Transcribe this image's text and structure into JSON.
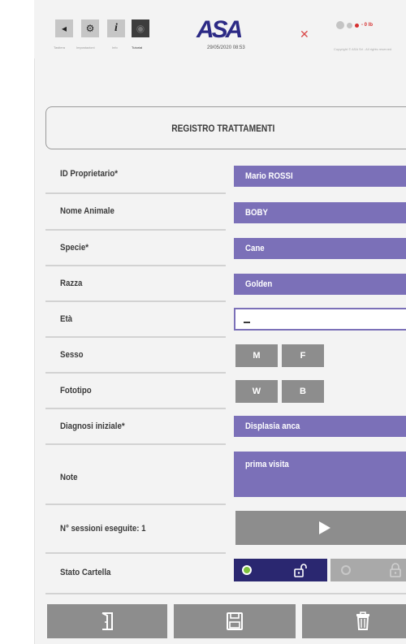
{
  "header": {
    "buttons": [
      {
        "icon": "back-arrow-icon",
        "glyph": "◂",
        "label": "Tastiera"
      },
      {
        "icon": "gear-icon",
        "glyph": "⚙",
        "label": "Impostazioni"
      },
      {
        "icon": "info-icon",
        "glyph": "i",
        "label": "Info"
      },
      {
        "icon": "eye-icon",
        "glyph": "◉",
        "label": "Tutorial"
      }
    ],
    "logo": "ASA",
    "datetime": "29/05/2020  08:53",
    "close_glyph": "✕",
    "status_text": "- 0 lb",
    "copyright": "Copyright © ASA Srl - All rights reserved"
  },
  "page_title": "REGISTRO TRATTAMENTI",
  "form": {
    "owner": {
      "label": "ID Proprietario*",
      "value": "Mario ROSSI"
    },
    "animal_name": {
      "label": "Nome Animale",
      "value": "BOBY"
    },
    "species": {
      "label": "Specie*",
      "value": "Cane"
    },
    "breed": {
      "label": "Razza",
      "value": "Golden"
    },
    "age": {
      "label": "Età",
      "value": ""
    },
    "sex": {
      "label": "Sesso",
      "options": [
        "M",
        "F"
      ]
    },
    "phototype": {
      "label": "Fototipo",
      "options": [
        "W",
        "B"
      ]
    },
    "diagnosis": {
      "label": "Diagnosi iniziale*",
      "value": "Displasia anca"
    },
    "notes": {
      "label": "Note",
      "value": "prima visita"
    },
    "sessions": {
      "label": "N° sessioni eseguite: 1"
    },
    "record_status": {
      "label": "Stato Cartella",
      "selected": "open"
    }
  },
  "bottom_bar": {
    "buttons": [
      {
        "name": "exit-button",
        "icon": "exit-door-icon"
      },
      {
        "name": "save-button",
        "icon": "floppy-disk-icon"
      },
      {
        "name": "delete-button",
        "icon": "trash-icon"
      }
    ]
  },
  "colors": {
    "accent": "#7b70b8",
    "dark_accent": "#2a2770",
    "button_gray": "#8d8d8d",
    "status_green": "#7ec23e",
    "alert_red": "#d94a4a"
  }
}
